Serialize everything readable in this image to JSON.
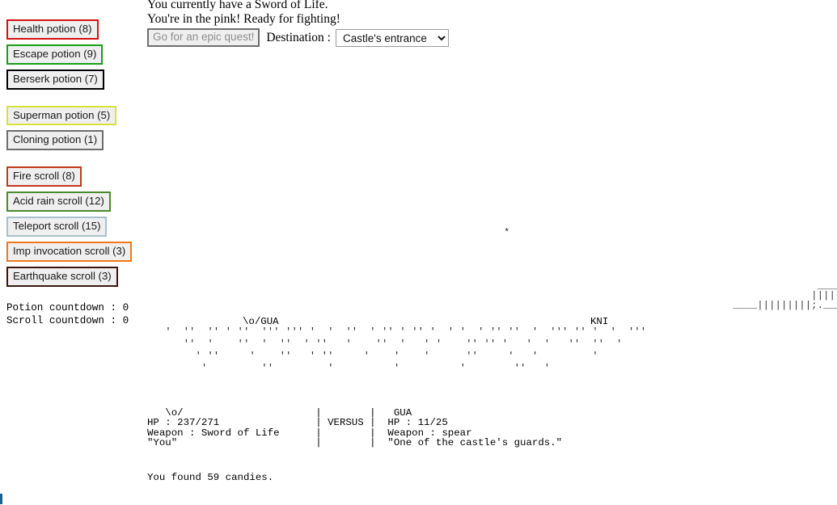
{
  "items": {
    "potions": [
      {
        "label": "Health potion (8)",
        "border_color": "#d51111",
        "name": "health-potion"
      },
      {
        "label": "Escape potion (9)",
        "border_color": "#16a016",
        "name": "escape-potion"
      },
      {
        "label": "Berserk potion (7)",
        "border_color": "#000000",
        "name": "berserk-potion"
      }
    ],
    "potions_group2": [
      {
        "label": "Superman potion (5)",
        "border_color": "#d6e33a",
        "name": "superman-potion"
      },
      {
        "label": "Cloning potion (1)",
        "border_color": "#6e6e6e",
        "name": "cloning-potion"
      }
    ],
    "scrolls": [
      {
        "label": "Fire scroll (8)",
        "border_color": "#c0391b",
        "name": "fire-scroll"
      },
      {
        "label": "Acid rain scroll (12)",
        "border_color": "#4b8a2e",
        "name": "acid-rain-scroll"
      },
      {
        "label": "Teleport scroll (15)",
        "border_color": "#a9c1ce",
        "name": "teleport-scroll"
      },
      {
        "label": "Imp invocation scroll (3)",
        "border_color": "#f07818",
        "name": "imp-invocation-scroll"
      },
      {
        "label": "Earthquake scroll (3)",
        "border_color": "#3c1410",
        "name": "earthquake-scroll"
      }
    ],
    "countdowns": "Potion countdown : 0\nScroll countdown : 0",
    "potion_countdown_label": "Potion countdown",
    "potion_countdown_value": "0",
    "scroll_countdown_label": "Scroll countdown",
    "scroll_countdown_value": "0"
  },
  "story": {
    "line1": "You currently have a Sword of Life.",
    "line2": "You're in the pink! Ready for fighting!"
  },
  "quest": {
    "button_label": "Go for an epic quest!",
    "destination_label": "Destination :",
    "destination_selected": "Castle's entrance",
    "destination_options": [
      "Castle's entrance"
    ]
  },
  "scene": {
    "sparkle": "*",
    "hero_marker": "\\o/GUA",
    "enemy_marker": "KNI",
    "castle_art": "                                   <*/\n                                    ()\n                                    |\\\n                                   ||| ||  ||  ||  || |\n                                   |`. `. `. `. `. `.|\n                                  :                .:;\n                                 \\-..______...:/\n                                 :-----------:_,'  ||  |\n                                 |]          .:|     `.`.\n                                 |  ,-.  .[|    _\n                                 |  | |  .:|'--'\n                                 |  |_|  .:|    _\n                                 |  '='  .:|   '--'\n                                 |       .:|\n                                 |  ___  .:|\n                                 | '--'  .:|\n                                 |       .:|      _\n                                 |       .:|     '-'\n                                 |      '-|\n                                 |       .:|        _\n                                 |       .:|       '--'\n                      ______     |  _    .:|\n                     ||||||||    | '-'   .:|     _\n        ____|||||||||;._______.::--------",
    "ground_art": "   '  ''  '' ' ''  ''' ''' '  '  ''  ' '' ' '' '  ' '  ' '' ''  '  ''' '' '  '  '''\n      ''  '    ''  '  ''  ' ''   '    ''  '   ' '    '' '' '   '  '   ''  ''  '\n        ' ''     '    ''   ' ''     '    '    '      ''     '   '         '\n         '         ''         '          '          '        ''   '",
    "battle": {
      "hero_icon": "\\o/",
      "hero_hp_label": "HP :",
      "hero_hp_value": "237/271",
      "hero_weapon_label": "Weapon :",
      "hero_weapon_value": "Sword of Life",
      "hero_quote": "\"You\"",
      "versus": "VERSUS",
      "enemy_name": "GUA",
      "enemy_hp_label": "HP :",
      "enemy_hp_value": "11/25",
      "enemy_weapon_label": "Weapon :",
      "enemy_weapon_value": "spear",
      "enemy_quote": "\"One of the castle's guards.\"",
      "block": "   \\o/                      |        |   GUA\nHP : 237/271                | VERSUS |  HP : 11/25\nWeapon : Sword of Life      |        |  Weapon : spear\n\"You\"                       |        |  \"One of the castle's guards.\""
    },
    "candies_line": "You found 59 candies."
  }
}
